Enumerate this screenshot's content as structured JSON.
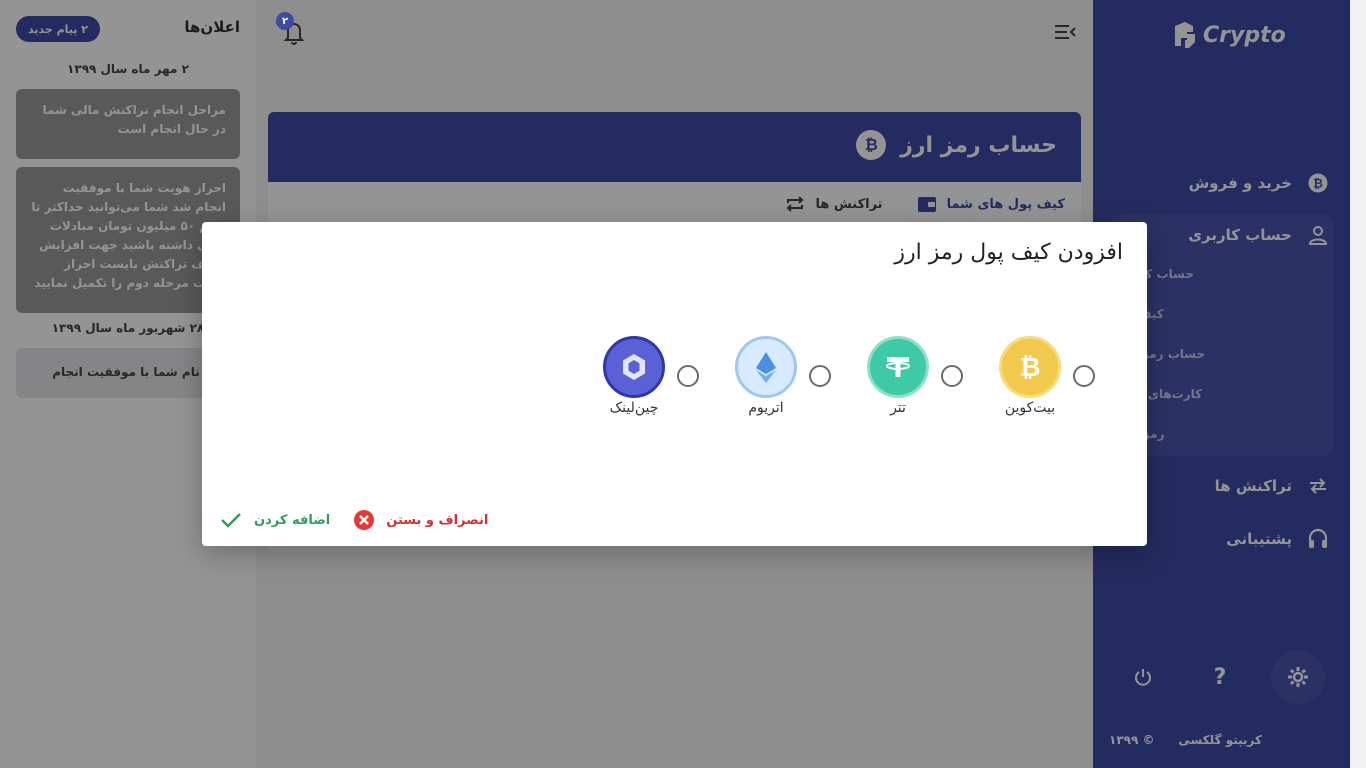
{
  "brand": {
    "name": "Crypto"
  },
  "sidebar": {
    "items": [
      {
        "label": "خرید و فروش",
        "icon": "bitcoin-icon"
      },
      {
        "label": "حساب کاربری",
        "icon": "user-icon"
      },
      {
        "label": "تراکنش ها",
        "icon": "transfer-icon"
      },
      {
        "label": "پشتیبانی",
        "icon": "headset-icon"
      }
    ],
    "sub_items": [
      {
        "label": "حساب کاربری"
      },
      {
        "label": "کیف پول"
      },
      {
        "label": "حساب رمزارزها"
      },
      {
        "label": "کارت‌های بانکی"
      },
      {
        "label": "رمز عبور"
      }
    ],
    "footer_brand": "کریپتو گلکسی",
    "footer_copyright": "© ۱۳۹۹"
  },
  "main": {
    "card_title": "حساب رمز ارز",
    "tabs": [
      {
        "label": "کیف پول های شما"
      },
      {
        "label": "تراکنش ها"
      }
    ]
  },
  "notifications": {
    "title": "اعلان‌ها",
    "bell_count": "۲",
    "new_badge": "۲ پیام جدید",
    "groups": [
      {
        "date": "۲ مهر ماه سال ۱۳۹۹",
        "items": [
          "مراحل انجام تراکنش مالی شما در حال انجام است",
          "احراز هویت شما با موفقیت انجام شد شما می‌توانید حداکثر تا حجم ۵۰ میلیون تومان مبادلات ارزی داشته باشید جهت افزایش سقف تراکنش بایست احراز هویت مرحله دوم را تکمیل نمایید"
        ]
      },
      {
        "date": "۲۸ شهریور ماه سال ۱۳۹۹",
        "items": [
          "ثبت نام شما با موفقیت انجام شد"
        ]
      }
    ]
  },
  "modal": {
    "title": "افزودن کیف پول رمز ارز",
    "coins": [
      {
        "label": "بیت‌کوین",
        "icon": "bitcoin-coin-icon",
        "color": "#f2c94c"
      },
      {
        "label": "تتر",
        "icon": "tether-coin-icon",
        "color": "#26a17b"
      },
      {
        "label": "اتریوم",
        "icon": "ethereum-coin-icon",
        "color": "#7fb6f2"
      },
      {
        "label": "چین‌لینک",
        "icon": "chainlink-coin-icon",
        "color": "#5a61d6"
      }
    ],
    "cancel_label": "انصراف و بستن",
    "add_label": "اضافه کردن"
  },
  "colors": {
    "primary": "#3f4aa6",
    "success": "#2e9e5b",
    "danger": "#d32f2f"
  }
}
